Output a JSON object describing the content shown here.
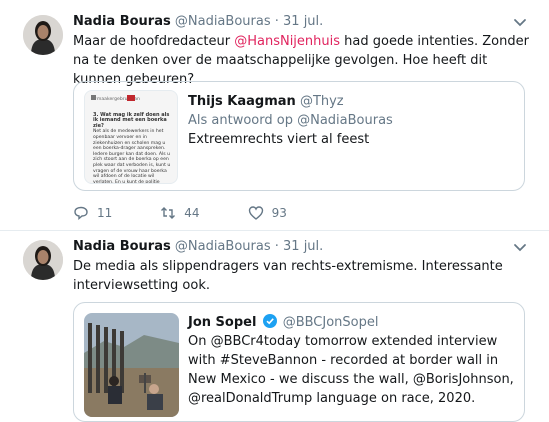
{
  "tweets": [
    {
      "author": "Nadia Bouras",
      "handle": "@NadiaBouras",
      "separator": "·",
      "date": "31 jul.",
      "text_before": "Maar de hoofdredacteur ",
      "mention": "@HansNijenhuis",
      "text_after": " had goede intenties. Zonder na te denken over de maatschappelijke gevolgen. Hoe heeft dit kunnen gebeuren?",
      "quote": {
        "author": "Thijs Kaagman",
        "handle": "@Thyz",
        "reply_to": "Als antwoord op @NadiaBouras",
        "text": "Extreemrechts viert al feest",
        "thumb_lines": [
          "#maakergebruikvan",
          "3. Wat mag ik zelf doen als ik iemand met een boerka zie?",
          "Net als de medewerkers in het openbaar vervoer en in ziekenhuizen en scholen mag u een boerka-drager aanspreken. Iedere burger kan dat doen. Als u zich stoort aan de boerka op een plek waar dat verboden is, kunt u vragen of de vrouw haar boerka wil afdoen of de locatie wil verlaten. En u kunt de politie bellen."
        ]
      },
      "actions": {
        "replies": "11",
        "retweets": "44",
        "likes": "93"
      }
    },
    {
      "author": "Nadia Bouras",
      "handle": "@NadiaBouras",
      "separator": "·",
      "date": "31 jul.",
      "text": "De media als slippendragers van rechts-extremisme. Interessante interviewsetting ook.",
      "quote": {
        "author": "Jon Sopel",
        "handle": "@BBCJonSopel",
        "text": "On @BBCr4today tomorrow extended interview with #SteveBannon - recorded at border wall in New Mexico - we discuss the wall, @BorisJohnson, @realDonaldTrump language on race, 2020."
      }
    }
  ],
  "colors": {
    "accent": "#e0245e",
    "muted": "#657786",
    "verified": "#1da1f2",
    "border": "#ccd6dd"
  }
}
